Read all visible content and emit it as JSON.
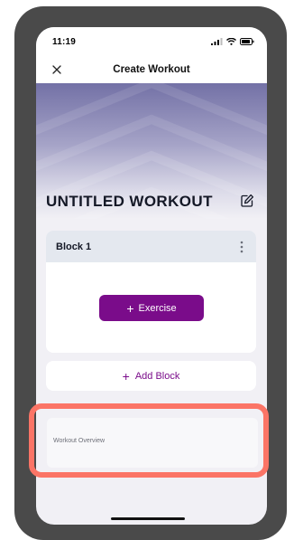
{
  "status_bar": {
    "time": "11:19",
    "icons": [
      "cellular-signal-icon",
      "wifi-icon",
      "battery-icon"
    ]
  },
  "nav": {
    "title": "Create Workout",
    "close_icon": "close-icon"
  },
  "workout": {
    "title": "UNTITLED WORKOUT",
    "edit_icon": "edit-icon"
  },
  "blocks": [
    {
      "title": "Block 1",
      "menu_icon": "more-vertical-icon",
      "add_exercise_label": "Exercise"
    }
  ],
  "add_block_label": "Add Block",
  "overview": {
    "label": "Workout Overview"
  },
  "colors": {
    "accent": "#7a0c8a",
    "highlight": "#fb7466",
    "hero_top": "#7371a6",
    "background": "#f1f0f5"
  }
}
